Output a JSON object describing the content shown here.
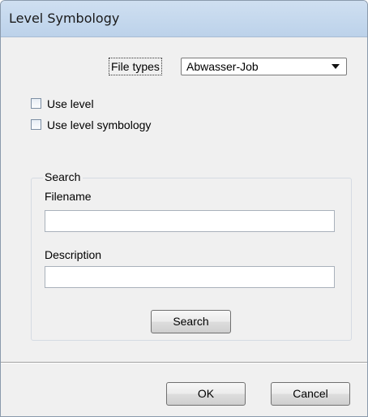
{
  "window": {
    "title": "Level Symbology"
  },
  "file_types": {
    "label": "File types",
    "selected_value": "Abwasser-Job"
  },
  "options": {
    "use_level_label": "Use level",
    "use_level_checked": false,
    "use_level_symbology_label": "Use level symbology",
    "use_level_symbology_checked": false
  },
  "search_group": {
    "legend": "Search",
    "filename_label": "Filename",
    "filename_value": "",
    "description_label": "Description",
    "description_value": "",
    "search_button_label": "Search"
  },
  "footer": {
    "ok_label": "OK",
    "cancel_label": "Cancel"
  },
  "icons": {
    "dropdown": "chevron-down-icon",
    "checkbox": "checkbox-unchecked-icon"
  },
  "colors": {
    "titlebar": "#c7dbf0",
    "client_background": "#f0f0f0"
  }
}
